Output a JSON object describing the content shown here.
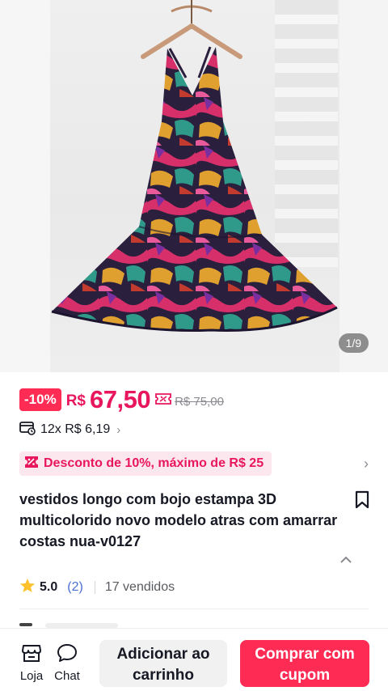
{
  "gallery": {
    "counter": "1/9",
    "image_name": "multicolor-print-halter-maxi-dress"
  },
  "price": {
    "discount_badge": "-10%",
    "currency": "R$",
    "amount": "67,50",
    "original": "R$ 75,00",
    "coupon_icon": "coupon-ticket-icon"
  },
  "installments": {
    "icon": "card-calendar-icon",
    "text": "12x R$ 6,19",
    "chevron": "›"
  },
  "promo": {
    "icon": "coupon-tag-icon",
    "text": "Desconto de 10%, máximo de R$ 25",
    "chevron": "›"
  },
  "product": {
    "title": "vestidos longo com bojo estampa 3D multicolorido novo modelo atras com amarrar costas nua-v0127",
    "rating": "5.0",
    "reviews": "(2)",
    "sold": "17 vendidos"
  },
  "bottom_bar": {
    "store_label": "Loja",
    "chat_label": "Chat",
    "add_to_cart": "Adicionar ao carrinho",
    "buy_with_coupon": "Comprar com cupom"
  },
  "colors": {
    "accent": "#fe2c55",
    "price": "#e8175d",
    "promo_bg": "#fde7ee"
  }
}
